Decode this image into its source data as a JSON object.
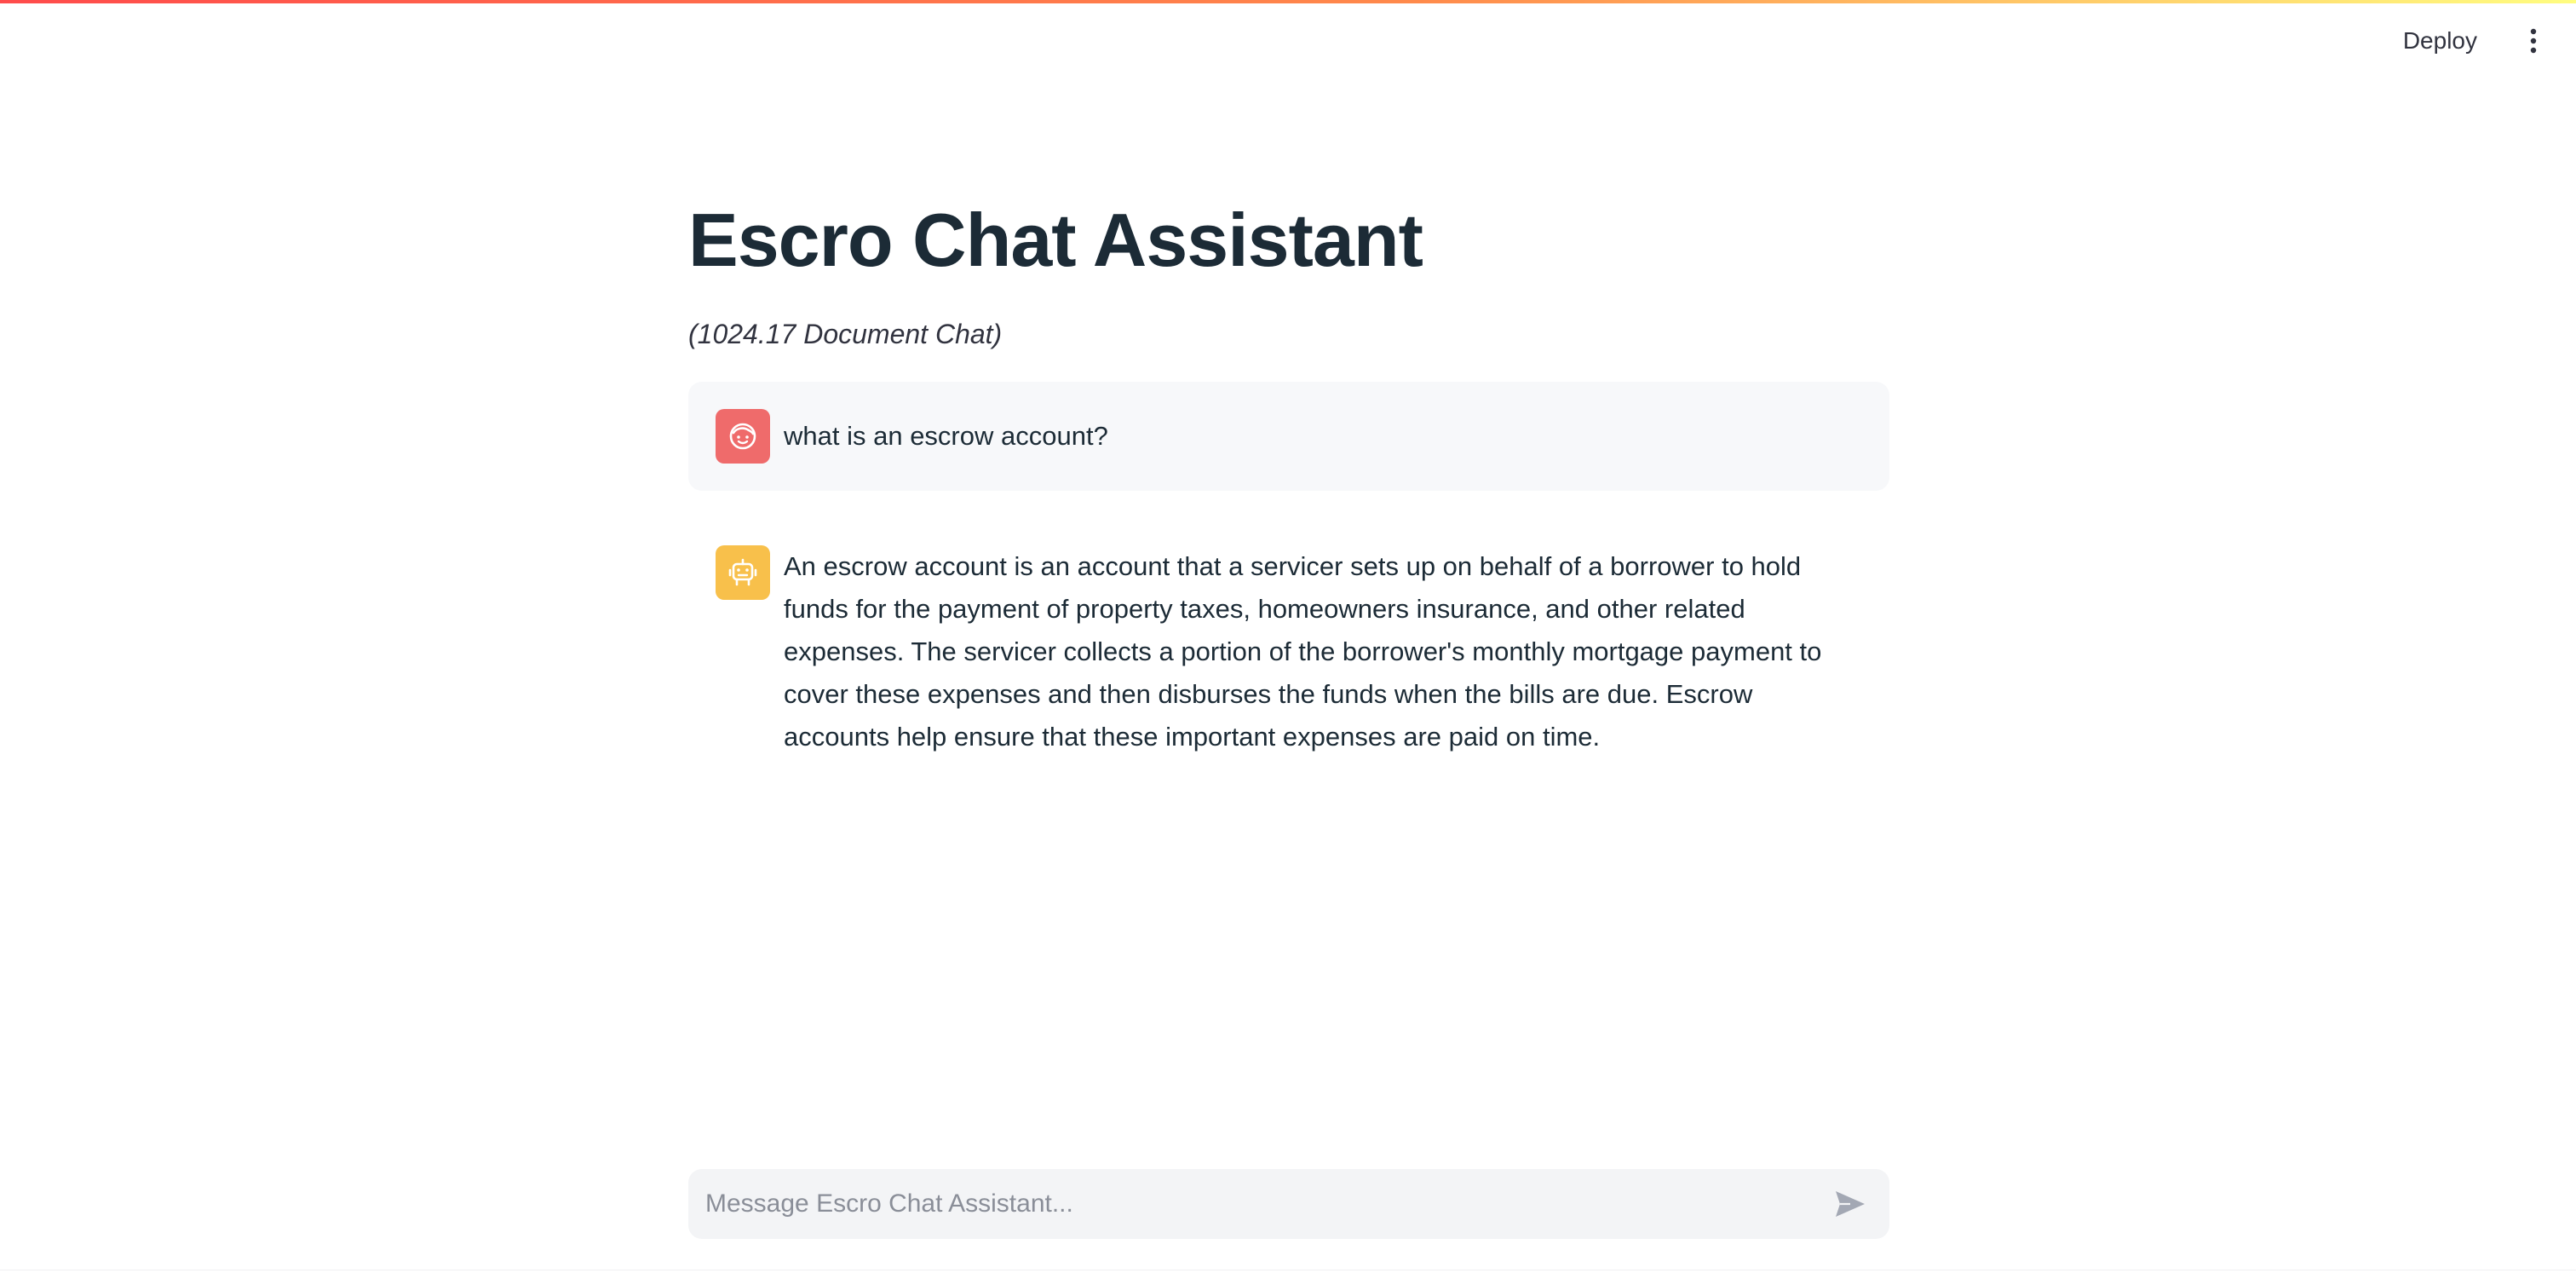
{
  "header": {
    "deploy_label": "Deploy",
    "menu_icon": "vertical-ellipsis-icon"
  },
  "page": {
    "title": "Escro Chat Assistant",
    "subtitle": "(1024.17 Document Chat)"
  },
  "messages": [
    {
      "role": "user",
      "avatar_icon": "user-face-icon",
      "text": "what is an escrow account?"
    },
    {
      "role": "assistant",
      "avatar_icon": "robot-icon",
      "text": "An escrow account is an account that a servicer sets up on behalf of a borrower to hold funds for the payment of property taxes, homeowners insurance, and other related expenses. The servicer collects a portion of the borrower's monthly mortgage payment to cover these expenses and then disburses the funds when the bills are due. Escrow accounts help ensure that these important expenses are paid on time."
    }
  ],
  "chat_input": {
    "placeholder": "Message Escro Chat Assistant...",
    "value": "",
    "send_icon": "send-icon"
  },
  "colors": {
    "user_avatar": "#ef6b6b",
    "assistant_avatar": "#f8c04b",
    "title": "#1c2b36",
    "message_bg": "#f7f8fa",
    "input_bg": "#f3f4f6"
  }
}
